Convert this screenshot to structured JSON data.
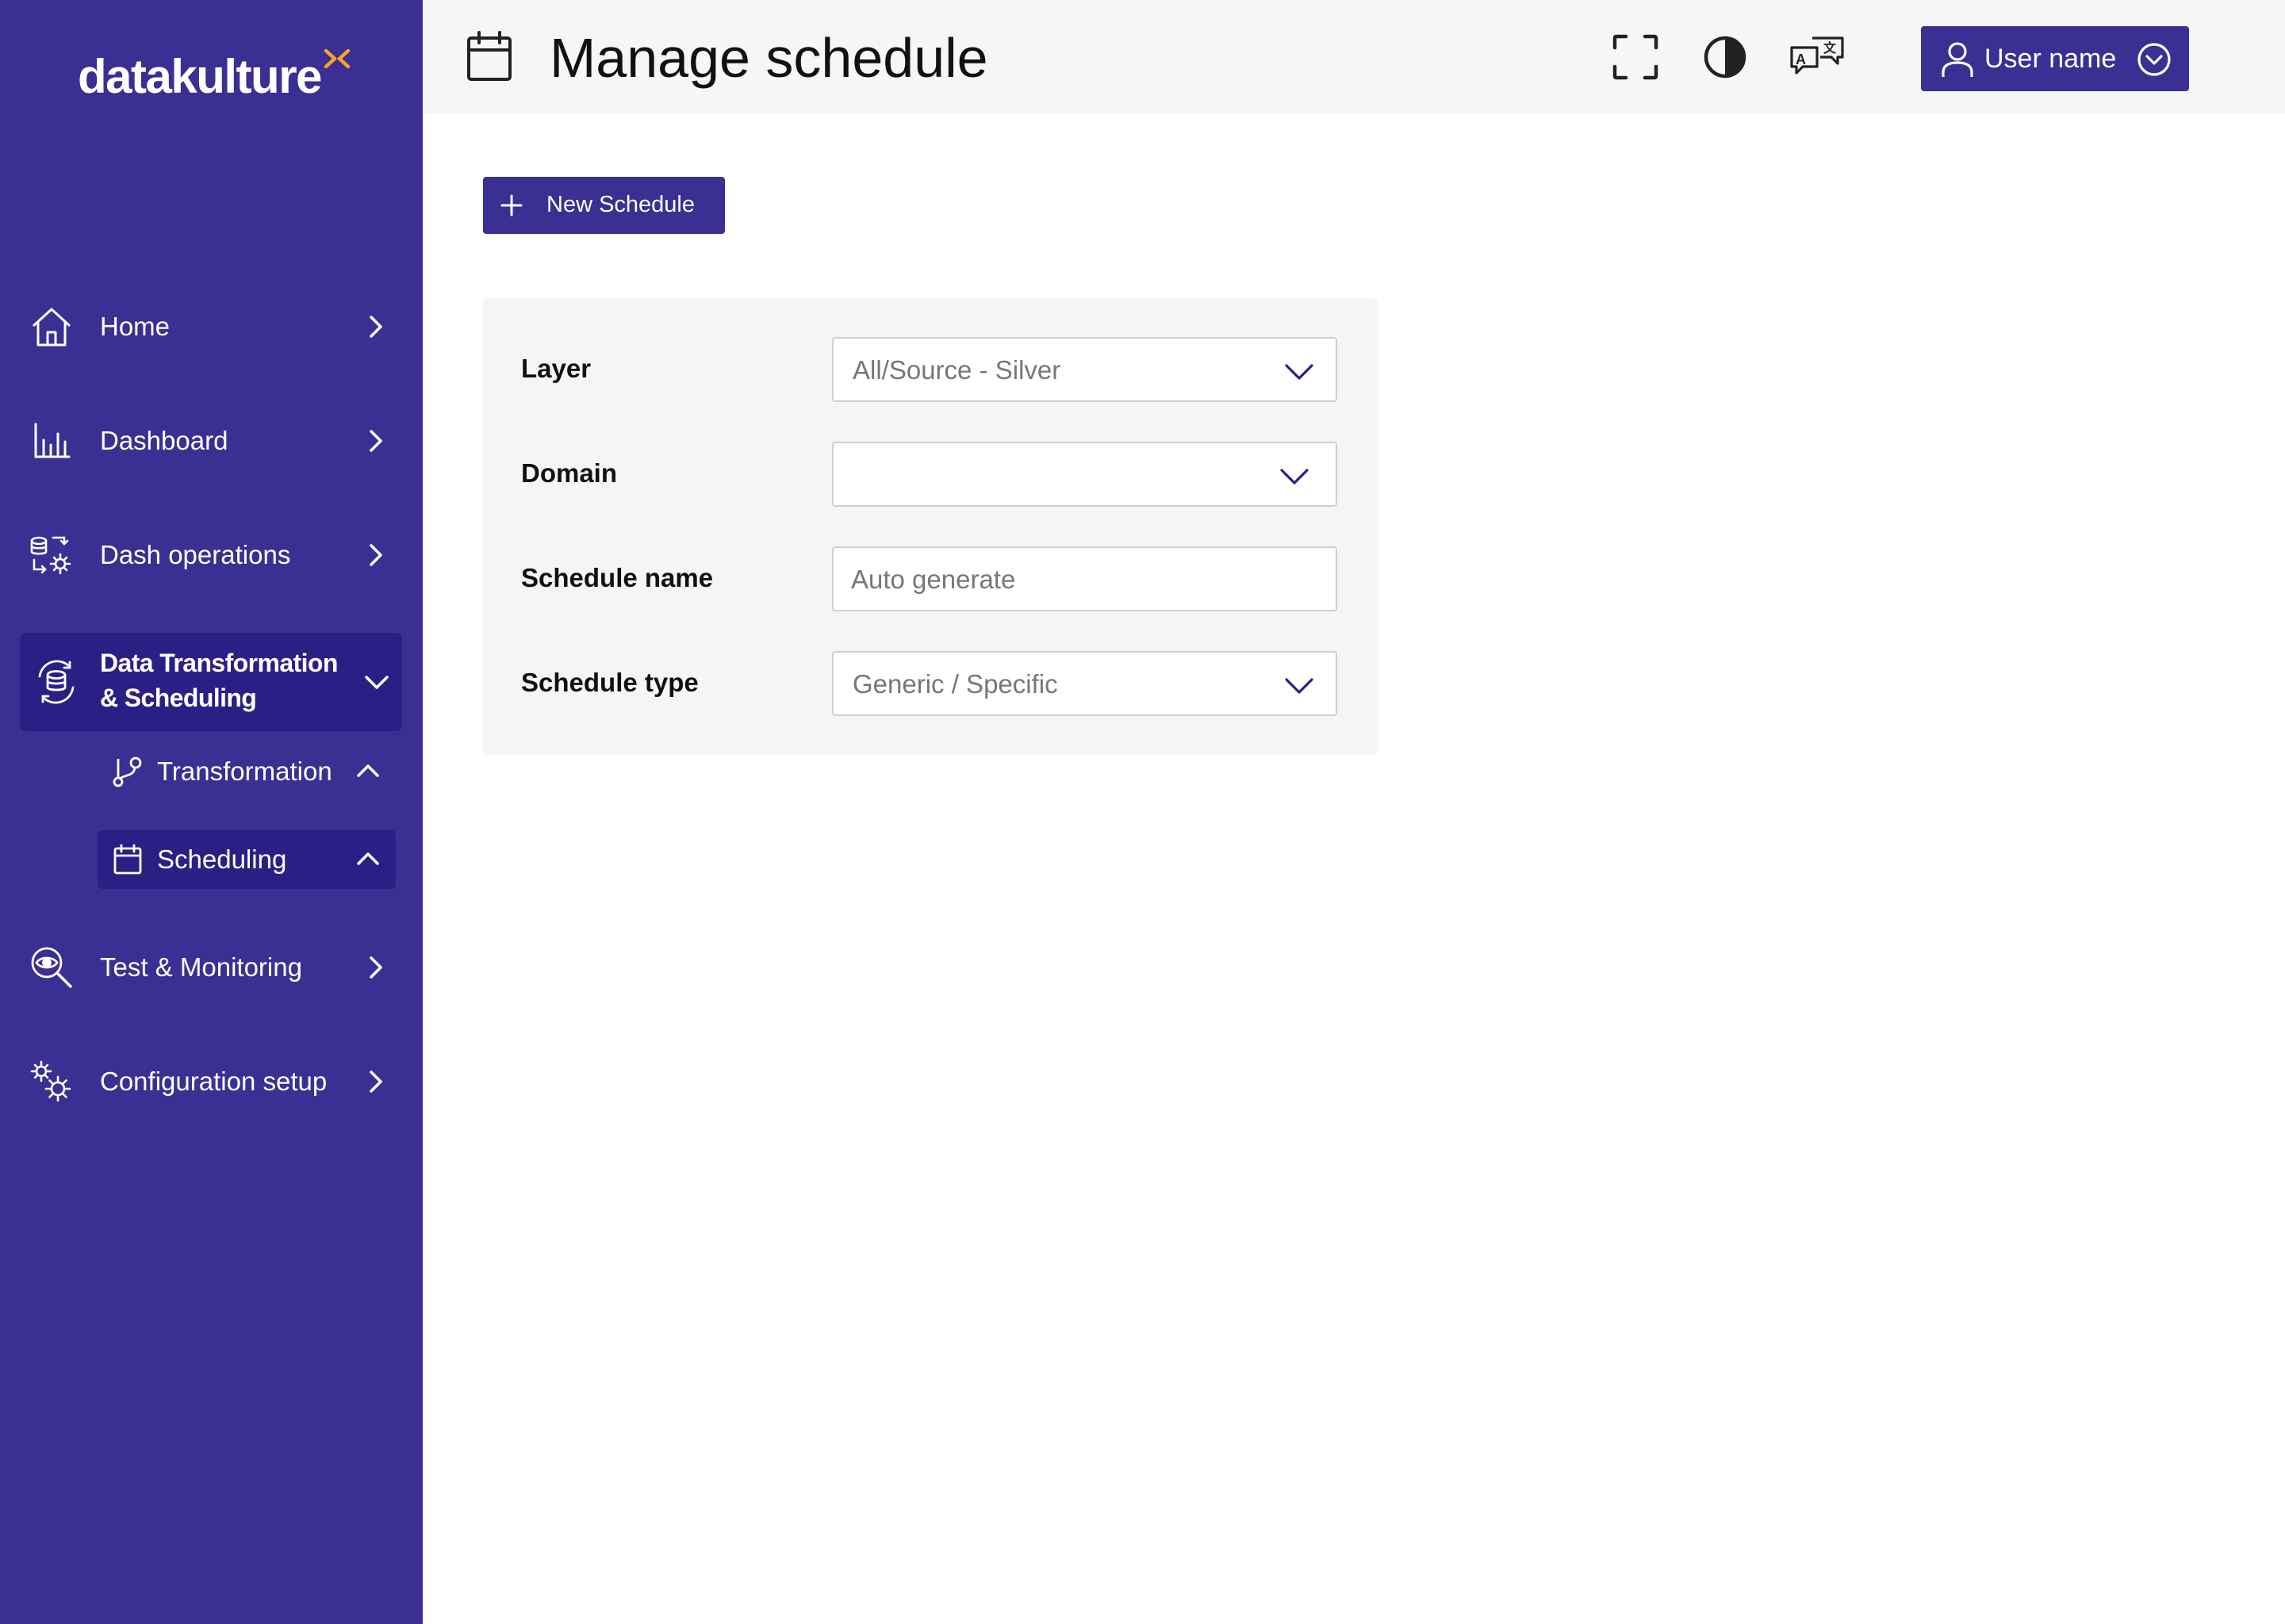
{
  "brand": {
    "logo_text": "datakulture",
    "accent_color": "#f5a623",
    "primary_color": "#3b2f93",
    "active_color": "#2b1f86"
  },
  "header": {
    "title": "Manage schedule",
    "title_icon": "calendar-icon",
    "actions": [
      {
        "icon": "fullscreen-icon"
      },
      {
        "icon": "contrast-icon"
      },
      {
        "icon": "translate-icon"
      }
    ],
    "user": {
      "name": "User name",
      "icon": "user-icon"
    }
  },
  "sidebar": {
    "items": [
      {
        "label": "Home",
        "icon": "home-icon"
      },
      {
        "label": "Dashboard",
        "icon": "bar-chart-icon"
      },
      {
        "label": "Dash operations",
        "icon": "database-gear-icon"
      },
      {
        "label_line1": "Data Transformation",
        "label_line2": "& Scheduling",
        "icon": "database-sync-icon",
        "expanded": true,
        "children": [
          {
            "label": "Transformation",
            "icon": "git-branch-icon"
          },
          {
            "label": "Scheduling",
            "icon": "calendar-icon",
            "selected": true
          }
        ]
      },
      {
        "label": "Test & Monitoring",
        "icon": "eye-search-icon"
      },
      {
        "label": "Configuration setup",
        "icon": "gears-icon"
      }
    ]
  },
  "main": {
    "new_button_label": "New Schedule",
    "form": {
      "layer": {
        "label": "Layer",
        "value": "All/Source - Silver"
      },
      "domain": {
        "label": "Domain",
        "value": ""
      },
      "schedule_name": {
        "label": "Schedule name",
        "value": "",
        "placeholder": "Auto generate"
      },
      "schedule_type": {
        "label": "Schedule type",
        "value": "Generic / Specific"
      }
    }
  }
}
